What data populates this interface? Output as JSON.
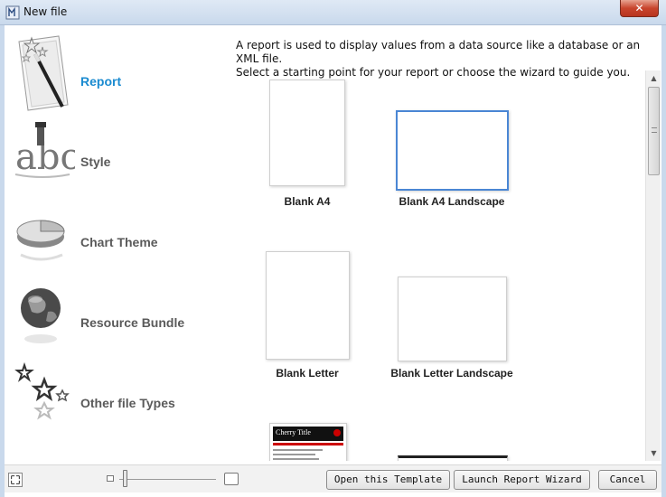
{
  "window": {
    "title": "New file",
    "close_label": "✕"
  },
  "sidebar": {
    "items": [
      {
        "label": "Report",
        "icon": "report-wand-icon",
        "active": true
      },
      {
        "label": "Style",
        "icon": "style-abc-icon",
        "active": false
      },
      {
        "label": "Chart Theme",
        "icon": "pie-chart-icon",
        "active": false
      },
      {
        "label": "Resource Bundle",
        "icon": "globe-icon",
        "active": false
      },
      {
        "label": "Other file Types",
        "icon": "stars-icon",
        "active": false
      }
    ]
  },
  "description": {
    "line1": "A report is used to display values from a data source like a database or an XML file.",
    "line2": "Select a starting point for your report or choose the wizard to guide you."
  },
  "templates": [
    {
      "label": "Blank A4",
      "selected": false
    },
    {
      "label": "Blank A4 Landscape",
      "selected": true
    },
    {
      "label": "Blank Letter",
      "selected": false
    },
    {
      "label": "Blank Letter Landscape",
      "selected": false
    },
    {
      "label": "Cherry Title",
      "selected": false
    }
  ],
  "buttons": {
    "open_template": "Open this Template",
    "launch_wizard": "Launch Report Wizard",
    "cancel": "Cancel"
  },
  "colors": {
    "accent": "#1b8bd0",
    "selection": "#4a86d4",
    "close": "#c8452d"
  }
}
